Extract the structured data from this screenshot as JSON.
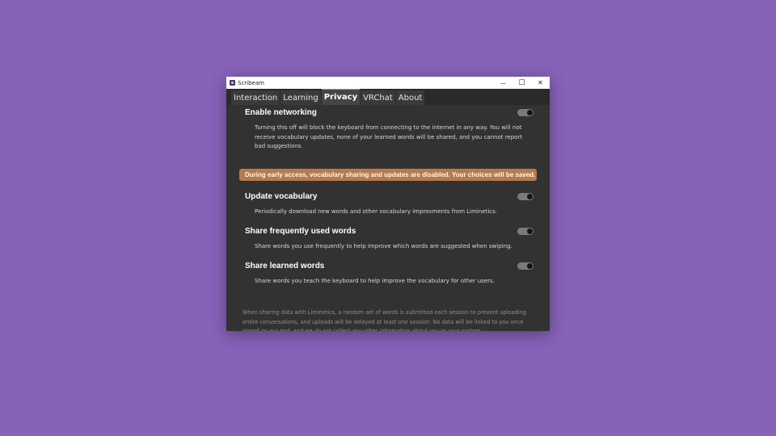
{
  "window": {
    "title": "Scribeam",
    "minimize": "—",
    "maximize": "☐",
    "close": "✕"
  },
  "tabs": [
    {
      "label": "Interaction",
      "active": false
    },
    {
      "label": "Learning",
      "active": false
    },
    {
      "label": "Privacy",
      "active": true
    },
    {
      "label": "VRChat",
      "active": false
    },
    {
      "label": "About",
      "active": false
    }
  ],
  "settings": {
    "networking": {
      "title": "Enable networking",
      "description": "Turning this off will block the keyboard from connecting to the internet in any way. You will not receive vocabulary updates, none of your learned words will be shared, and you cannot report bad suggestions.",
      "enabled": true
    },
    "banner": "During early access, vocabulary sharing and updates are disabled. Your choices will be saved.",
    "update_vocabulary": {
      "title": "Update vocabulary",
      "description": "Periodically download new words and other vocabulary improvments from Liminetics.",
      "enabled": true
    },
    "share_frequent": {
      "title": "Share frequently used words",
      "description": "Share words you use frequently to help improve which words are suggested when swiping.",
      "enabled": true
    },
    "share_learned": {
      "title": "Share learned words",
      "description": "Share words you teach the keyboard to help improve the vocabulary for other users.",
      "enabled": true
    }
  },
  "footer_note": "When sharing data with Liminetics, a random set of words is submitted each session to prevent uploading entire conversations, and uploads will be delayed at least one session. No data will be linked to you once stored on our end, and we do not collect any other information about you or your system.",
  "colors": {
    "desktop": "#8662b8",
    "window_bg": "#323232",
    "banner": "#b77a4e",
    "toggle_track": "#7a7a7a"
  }
}
